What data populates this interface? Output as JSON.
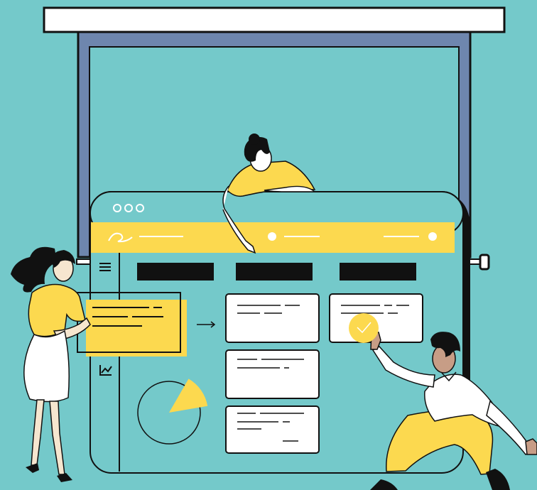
{
  "colors": {
    "background": "#74c9ca",
    "accent_yellow": "#fcd94f",
    "ink": "#111111",
    "frame_blue": "#6e86ae",
    "paper": "#ffffff",
    "skin_light": "#f6e6cf",
    "skin_dark": "#c79d86"
  },
  "icons": {
    "window_controls": "three-dot-window-controls-icon",
    "signature": "signature-scribble-icon",
    "menu": "hamburger-menu-icon",
    "trend": "trend-chart-icon",
    "arrow": "right-arrow-icon",
    "check": "checkmark-icon"
  },
  "pie_highlight_fraction": 0.14
}
